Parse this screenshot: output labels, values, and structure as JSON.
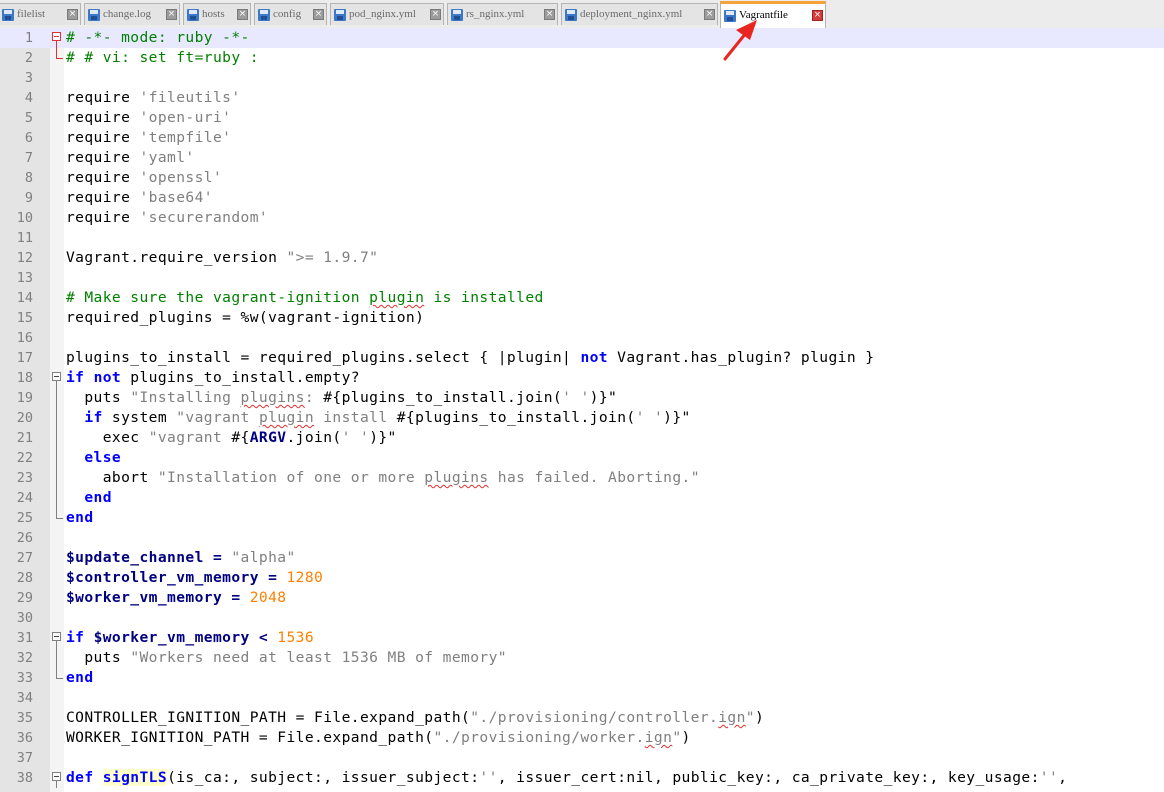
{
  "tabs": [
    {
      "label": "filelist",
      "active": false,
      "color": "#e4e4e4"
    },
    {
      "label": "change.log",
      "active": false
    },
    {
      "label": "hosts",
      "active": false
    },
    {
      "label": "config",
      "active": false
    },
    {
      "label": "pod_nginx.yml",
      "active": false
    },
    {
      "label": "rs_nginx.yml",
      "active": false
    },
    {
      "label": "deployment_nginx.yml",
      "active": false
    },
    {
      "label": "Vagrantfile",
      "active": true
    }
  ],
  "colors": {
    "active_tab_accent": "#f4a23a",
    "comment": "#008000",
    "string": "#808080",
    "number": "#ff8000",
    "keyword": "#0000ff",
    "annotation_arrow": "#e8251e"
  },
  "editor": {
    "current_line": 1,
    "lines": [
      {
        "n": "1"
      },
      {
        "n": "2"
      },
      {
        "n": "3"
      },
      {
        "n": "4"
      },
      {
        "n": "5"
      },
      {
        "n": "6"
      },
      {
        "n": "7"
      },
      {
        "n": "8"
      },
      {
        "n": "9"
      },
      {
        "n": "10"
      },
      {
        "n": "11"
      },
      {
        "n": "12"
      },
      {
        "n": "13"
      },
      {
        "n": "14"
      },
      {
        "n": "15"
      },
      {
        "n": "16"
      },
      {
        "n": "17"
      },
      {
        "n": "18"
      },
      {
        "n": "19"
      },
      {
        "n": "20"
      },
      {
        "n": "21"
      },
      {
        "n": "22"
      },
      {
        "n": "23"
      },
      {
        "n": "24"
      },
      {
        "n": "25"
      },
      {
        "n": "26"
      },
      {
        "n": "27"
      },
      {
        "n": "28"
      },
      {
        "n": "29"
      },
      {
        "n": "30"
      },
      {
        "n": "31"
      },
      {
        "n": "32"
      },
      {
        "n": "33"
      },
      {
        "n": "34"
      },
      {
        "n": "35"
      },
      {
        "n": "36"
      },
      {
        "n": "37"
      },
      {
        "n": "38"
      }
    ],
    "code": {
      "l1": "# -*- mode: ruby -*-",
      "l2": "# # vi: set ft=ruby :",
      "require": "require",
      "l4": "'fileutils'",
      "l5": "'open-uri'",
      "l6": "'tempfile'",
      "l7": "'yaml'",
      "l8": "'openssl'",
      "l9": "'base64'",
      "l10": "'securerandom'",
      "l12a": "Vagrant.require_version",
      "l12b": "\">= 1.9.7\"",
      "l14a": "# Make sure the vagrant-ignition ",
      "l14b": "plugin",
      "l14c": " is installed",
      "l15": "required_plugins = %w(vagrant-ignition)",
      "l17a": "plugins_to_install = required_plugins.select { |plugin| ",
      "l17b": "not",
      "l17c": " Vagrant.has_plugin? plugin }",
      "kw_if": "if",
      "kw_not": "not",
      "l18b": " plugins_to_install.empty?",
      "l19a": "  puts ",
      "l19b": "\"Installing ",
      "l19c": "plugins",
      "l19d": ": ",
      "l19e": "#{plugins_to_install.join(",
      "l19f": "' '",
      "l19g": ")}\"",
      "l20a": "  ",
      "l20b": " system ",
      "l20c": "\"vagrant ",
      "l20d": "plugin",
      "l20e": " install ",
      "l20f": "#{plugins_to_install.join(",
      "l20g": "' '",
      "l20h": ")}\"",
      "l21a": "    exec ",
      "l21b": "\"vagrant ",
      "l21c": "#{",
      "l21d": "ARGV",
      "l21e": ".join(",
      "l21f": "' '",
      "l21g": ")}\"",
      "kw_else": "else",
      "l23a": "    abort ",
      "l23b": "\"Installation of one or more ",
      "l23c": "plugins",
      "l23d": " has failed. Aborting.\"",
      "kw_end": "end",
      "l27a": "$update_channel",
      "l27b": " = ",
      "l27c": "\"alpha\"",
      "l28a": "$controller_vm_memory",
      "l28b": " = ",
      "l28c": "1280",
      "l29a": "$worker_vm_memory",
      "l29b": " = ",
      "l29c": "2048",
      "l31a": "$worker_vm_memory",
      "l31b": " < ",
      "l31c": "1536",
      "l32a": "  puts ",
      "l32b": "\"Workers need at least 1536 MB of memory\"",
      "l35a": "CONTROLLER_IGNITION_PATH = File.expand_path(",
      "l35b": "\"./provisioning/controller.",
      "l35c": "ign",
      "l35d": "\"",
      "l35e": ")",
      "l36a": "WORKER_IGNITION_PATH = File.expand_path(",
      "l36b": "\"./provisioning/worker.",
      "l36c": "ign",
      "l36d": "\"",
      "l36e": ")",
      "kw_def": "def",
      "l38b": "signTLS",
      "l38c": "(is_ca:, subject:, issuer_subject:",
      "l38d": "''",
      "l38e": ", issuer_cert:nil, public_key:, ca_private_key:, key_usage:",
      "l38f": "''",
      "l38g": ","
    }
  }
}
